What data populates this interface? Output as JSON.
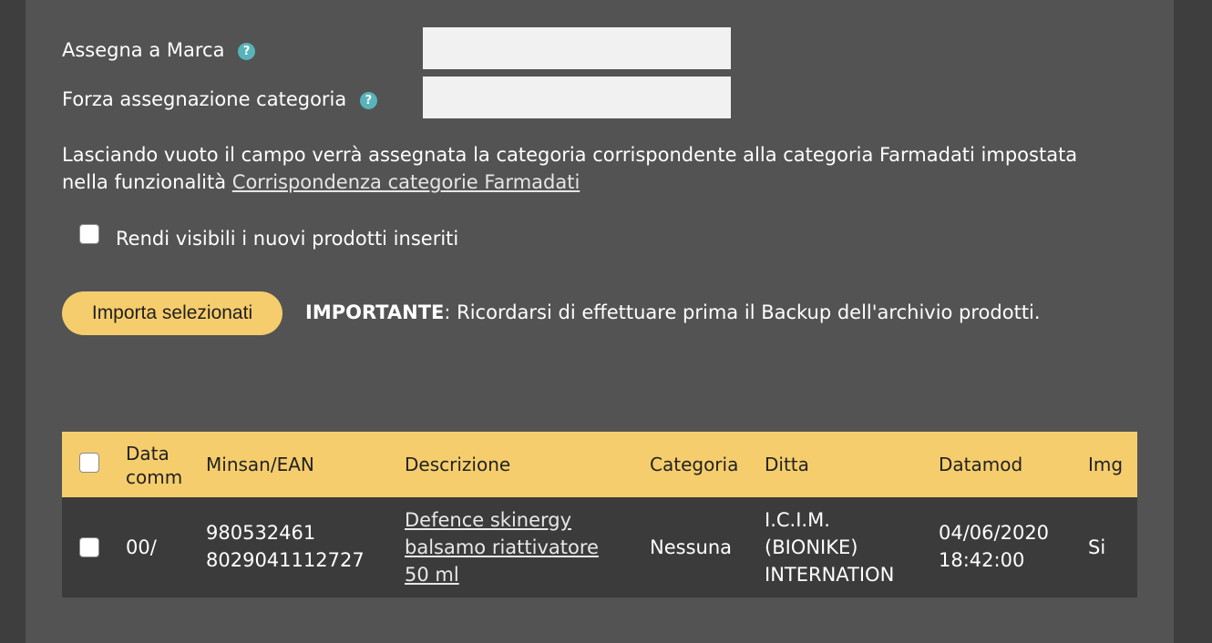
{
  "form": {
    "brand_label": "Assegna a Marca",
    "brand_value": "",
    "category_label": "Forza assegnazione categoria",
    "category_value": "",
    "help_glyph": "?",
    "note_text": "Lasciando vuoto il campo verrà assegnata la categoria corrispondente alla categoria Farmadati impostata nella funzionalità ",
    "note_link": "Corrispondenza categorie Farmadati",
    "visible_checkbox_label": "Rendi visibili i nuovi prodotti inseriti",
    "visible_checked": false
  },
  "actions": {
    "import_button": "Importa selezionati",
    "important_label": "IMPORTANTE",
    "important_text": ": Ricordarsi di effettuare prima il Backup dell'archivio prodotti."
  },
  "table": {
    "headers": {
      "date": "Data\ncomm",
      "ean": "Minsan/EAN",
      "description": "Descrizione",
      "category": "Categoria",
      "company": "Ditta",
      "datamod": "Datamod",
      "img": "Img"
    },
    "rows": [
      {
        "checked": false,
        "date": "00/",
        "ean": "980532461\n8029041112727",
        "description": "Defence skinergy\nbalsamo riattivatore\n50 ml",
        "category": "Nessuna",
        "company": "I.C.I.M.\n(BIONIKE)\nINTERNATION",
        "datamod": "04/06/2020\n18:42:00",
        "img": "Si"
      }
    ]
  },
  "colors": {
    "page_background": "#3e3e3e",
    "panel": "#535353",
    "accent_yellow": "#f6cd6d",
    "row_background": "#3b3b3b",
    "help_icon": "#59b3ba"
  }
}
